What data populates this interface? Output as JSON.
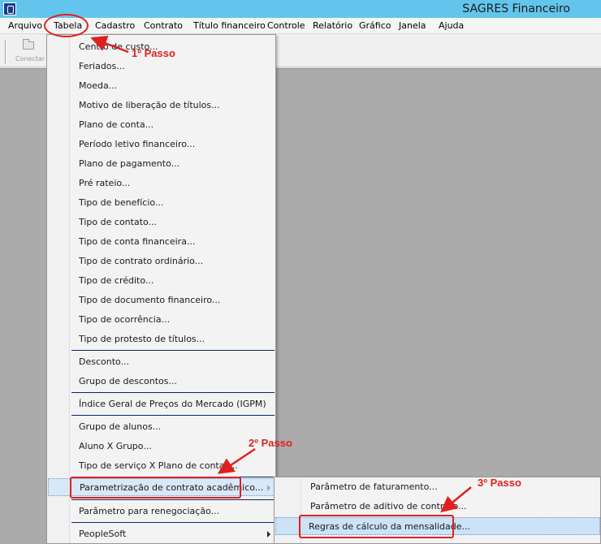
{
  "window": {
    "title": "SAGRES Financeiro",
    "icon": "app-icon"
  },
  "menubar": {
    "items": [
      "Arquivo",
      "Tabela",
      "Cadastro",
      "Contrato",
      "Título financeiro",
      "Controle",
      "Relatório",
      "Gráfico",
      "Janela",
      "Ajuda"
    ],
    "active": "Tabela"
  },
  "toolbar": {
    "connect_label": "Conectar",
    "connect_icon": "folder-open-icon"
  },
  "tabela_menu": {
    "items": [
      "Centro de custo...",
      "Feriados...",
      "Moeda...",
      "Motivo de liberação de títulos...",
      "Plano de conta...",
      "Período letivo financeiro...",
      "Plano de pagamento...",
      "Pré rateio...",
      "Tipo de benefício...",
      "Tipo de contato...",
      "Tipo de conta financeira...",
      "Tipo de contrato ordinário...",
      "Tipo de crédito...",
      "Tipo de documento financeiro...",
      "Tipo de ocorrência...",
      "Tipo de protesto de títulos...",
      "Desconto...",
      "Grupo de descontos...",
      "Índice Geral de Preços do Mercado (IGPM)",
      "Grupo de alunos...",
      "Aluno X Grupo...",
      "Tipo de serviço X Plano de contas...",
      "Parametrização de contrato acadêmico...",
      "Parâmetro para renegociação...",
      "PeopleSoft"
    ],
    "highlighted": "Parametrização de contrato acadêmico..."
  },
  "submenu": {
    "items": [
      "Parâmetro de faturamento...",
      "Parâmetro de aditivo de contrato...",
      "Regras de cálculo da mensalidade..."
    ],
    "highlighted": "Regras de cálculo da mensalidade..."
  },
  "annotations": {
    "step1": "1º Passo",
    "step2": "2º Passo",
    "step3": "3º Passo"
  },
  "colors": {
    "title_bar": "#63c5ec",
    "workspace": "#ababab",
    "annotation": "#e02020",
    "highlight": "#d8e8f7"
  }
}
